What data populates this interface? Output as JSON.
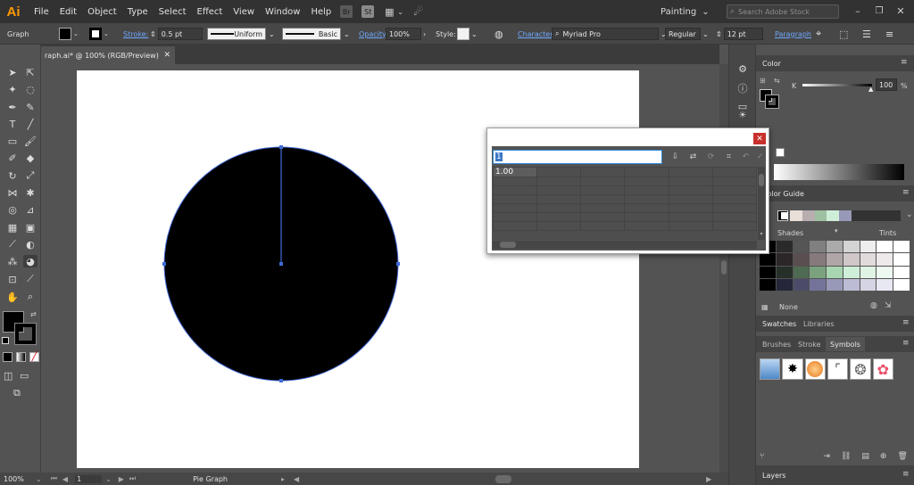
{
  "app": {
    "logo": "Ai",
    "menu": [
      "File",
      "Edit",
      "Object",
      "Type",
      "Select",
      "Effect",
      "View",
      "Window",
      "Help"
    ],
    "br_icon": "Br",
    "st_icon": "St",
    "workspace": "Painting",
    "search_placeholder": "Search Adobe Stock"
  },
  "control_bar": {
    "selection_type": "Graph",
    "stroke_label": "Stroke:",
    "stroke_weight": "0.5 pt",
    "uniform_label": "Uniform",
    "basic_label": "Basic",
    "opacity_label": "Opacity:",
    "opacity_value": "100%",
    "style_label": "Style:",
    "character_label": "Character:",
    "font_name": "Myriad Pro",
    "font_style": "Regular",
    "font_size": "12 pt",
    "paragraph_label": "Paragraph"
  },
  "document": {
    "tab_title": "raph.ai* @ 100% (RGB/Preview)"
  },
  "status_bar": {
    "zoom": "100%",
    "artboard_number": "1",
    "tool_name": "Pie Graph"
  },
  "graph_data_dialog": {
    "cell_entry": "1",
    "first_cell_value": "1.00"
  },
  "color_panel": {
    "tab": "Color",
    "channel_label": "K",
    "channel_value": "100",
    "percent": "%"
  },
  "color_guide_panel": {
    "tab": "Color Guide",
    "shades_label": "Shades",
    "tints_label": "Tints",
    "none_label": "None"
  },
  "swatches_panel": {
    "tabs": [
      "Swatches",
      "Libraries"
    ]
  },
  "symbols_panel": {
    "tabs": [
      "Brushes",
      "Stroke",
      "Symbols"
    ]
  },
  "layers_panel": {
    "tab": "Layers"
  },
  "colors": {
    "app_bg": "#535353",
    "menubar": "#323232",
    "logo": "#ff9a00",
    "selection_blue": "#3f6ad8",
    "pie_fill": "#000000",
    "close_red": "#c8312b"
  }
}
